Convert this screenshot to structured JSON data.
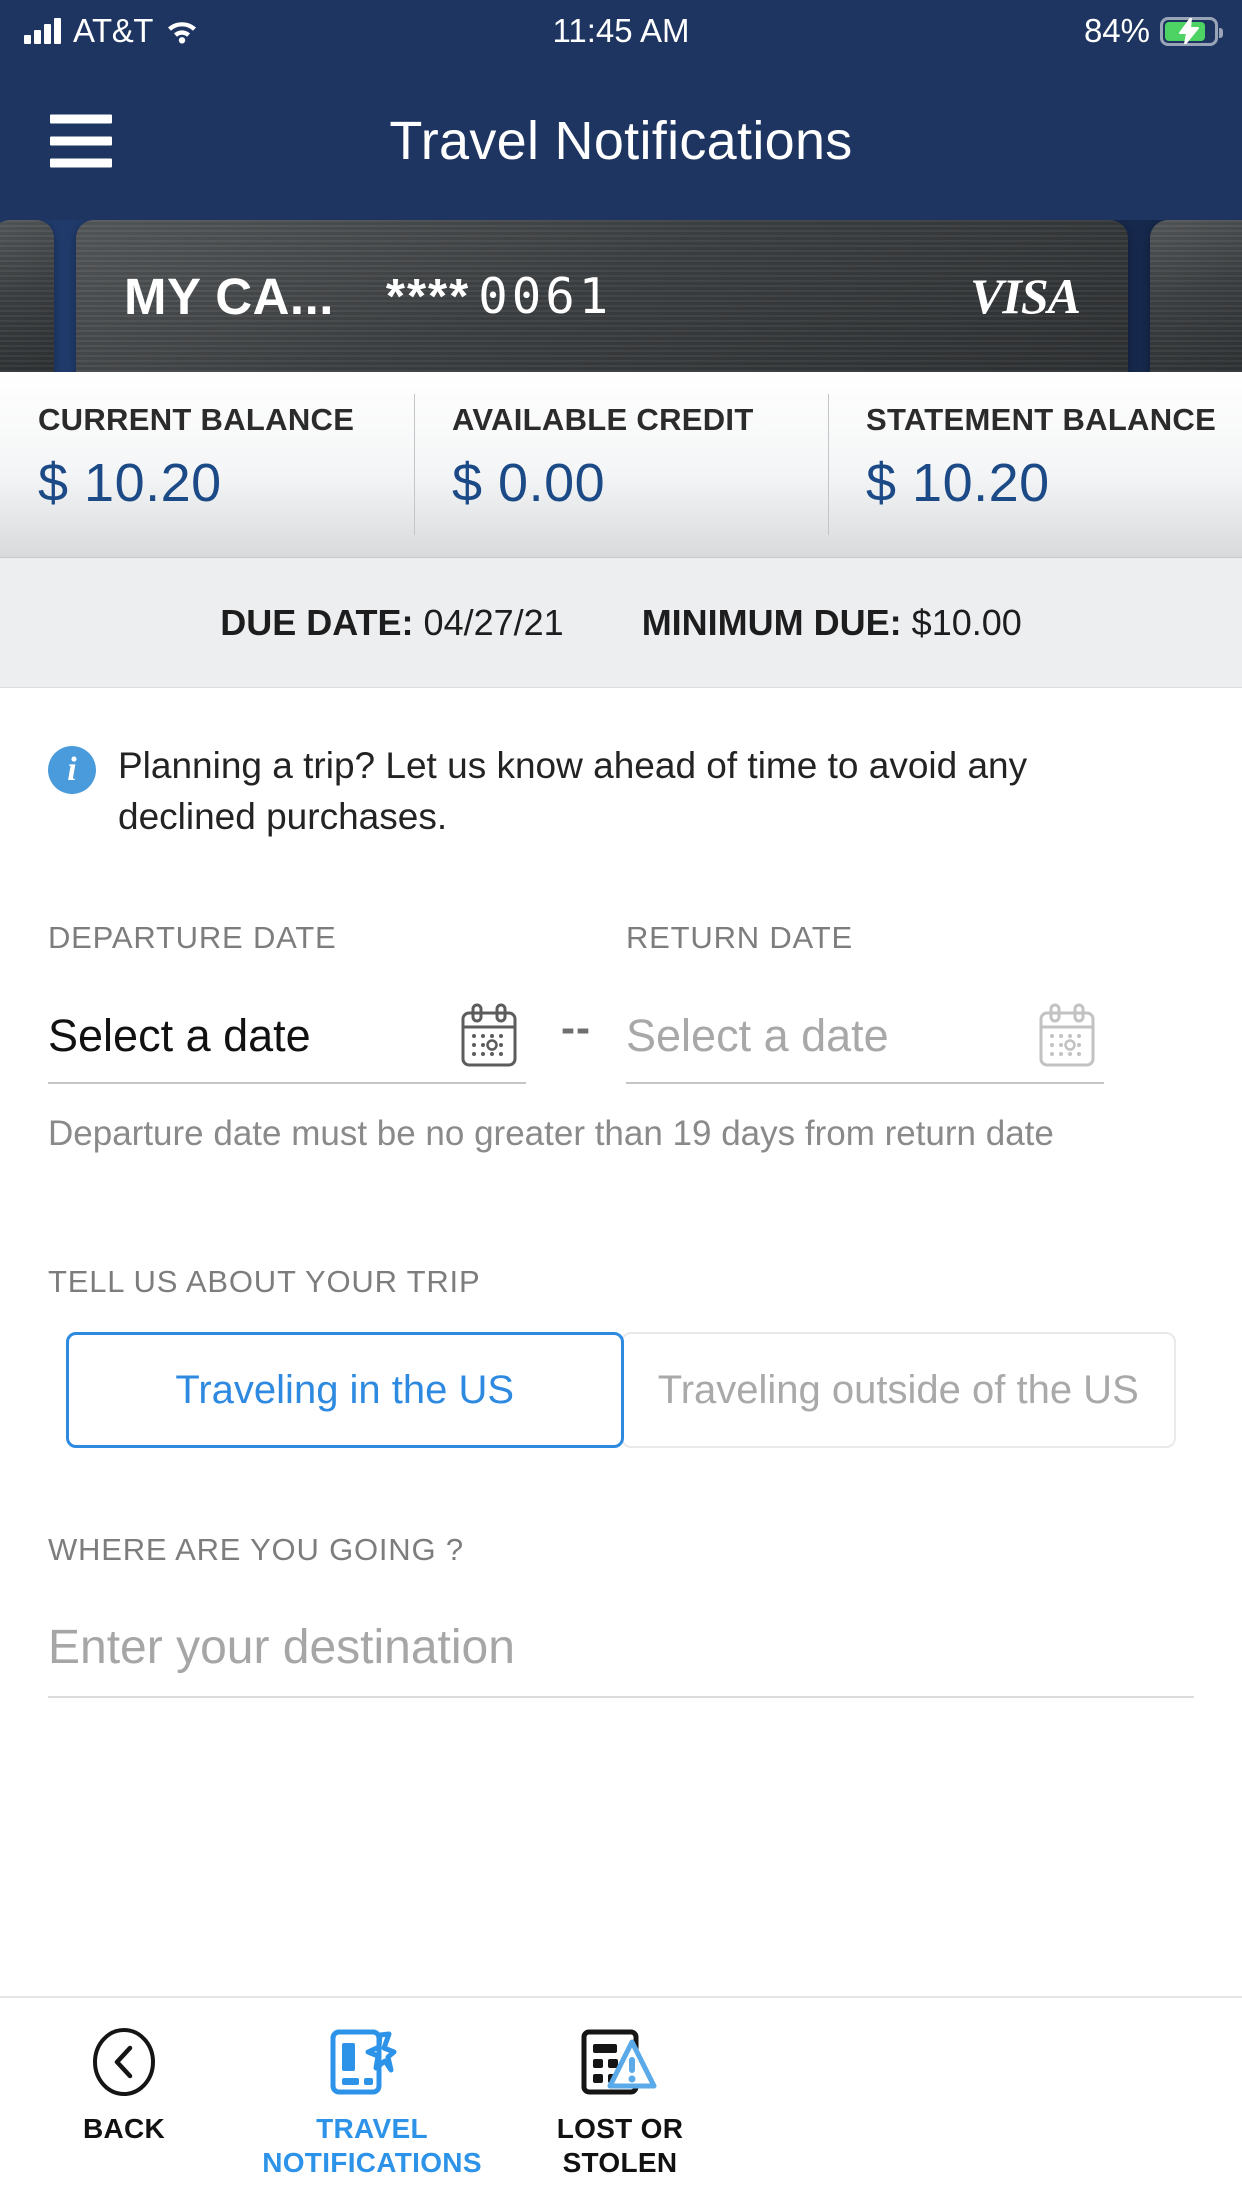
{
  "status_bar": {
    "carrier": "AT&T",
    "signal_icon": "signal-bars-icon",
    "wifi_icon": "wifi-icon",
    "time": "11:45 AM",
    "battery_percent": "84%",
    "battery_icon": "battery-charging-icon",
    "battery_level": 84
  },
  "header": {
    "menu_icon": "hamburger-menu-icon",
    "title": "Travel Notifications",
    "background_color": "#1e3561"
  },
  "card": {
    "nickname": "MY CA...",
    "mask": "****",
    "last_four": "0061",
    "network": "VISA"
  },
  "balances": [
    {
      "label": "CURRENT BALANCE",
      "value": "$ 10.20"
    },
    {
      "label": "AVAILABLE CREDIT",
      "value": "$ 0.00"
    },
    {
      "label": "STATEMENT BALANCE",
      "value": "$ 10.20"
    }
  ],
  "due": {
    "due_date_label": "DUE DATE:",
    "due_date_value": "04/27/21",
    "minimum_due_label": "MINIMUM DUE:",
    "minimum_due_value": "$10.00"
  },
  "info_banner": {
    "icon": "info-circle-icon",
    "text": "Planning a trip? Let us know ahead of time to avoid any declined purchases.",
    "icon_color": "#4a9bdb"
  },
  "dates": {
    "departure_label": "DEPARTURE DATE",
    "departure_placeholder": "Select a date",
    "return_label": "RETURN DATE",
    "return_placeholder": "Select a date",
    "separator": "--",
    "calendar_icon": "calendar-icon",
    "helper_text": "Departure date must be no greater than 19 days from return date"
  },
  "trip": {
    "label": "TELL US ABOUT YOUR TRIP",
    "options": [
      {
        "label": "Traveling in the US",
        "selected": true
      },
      {
        "label": "Traveling outside of the US",
        "selected": false
      }
    ],
    "accent_color": "#2d8ae0"
  },
  "destination": {
    "label": "WHERE ARE YOU GOING ?",
    "placeholder": "Enter your destination",
    "value": ""
  },
  "tab_bar": {
    "tabs": [
      {
        "label": "BACK",
        "icon": "back-chevron-circle-icon",
        "active": false
      },
      {
        "label": "TRAVEL\nNOTIFICATIONS",
        "label_line1": "TRAVEL",
        "label_line2": "NOTIFICATIONS",
        "icon": "card-airplane-icon",
        "active": true
      },
      {
        "label": "LOST OR\nSTOLEN",
        "label_line1": "LOST OR",
        "label_line2": "STOLEN",
        "icon": "card-warning-icon",
        "active": false
      }
    ],
    "active_color": "#2d93e8"
  }
}
